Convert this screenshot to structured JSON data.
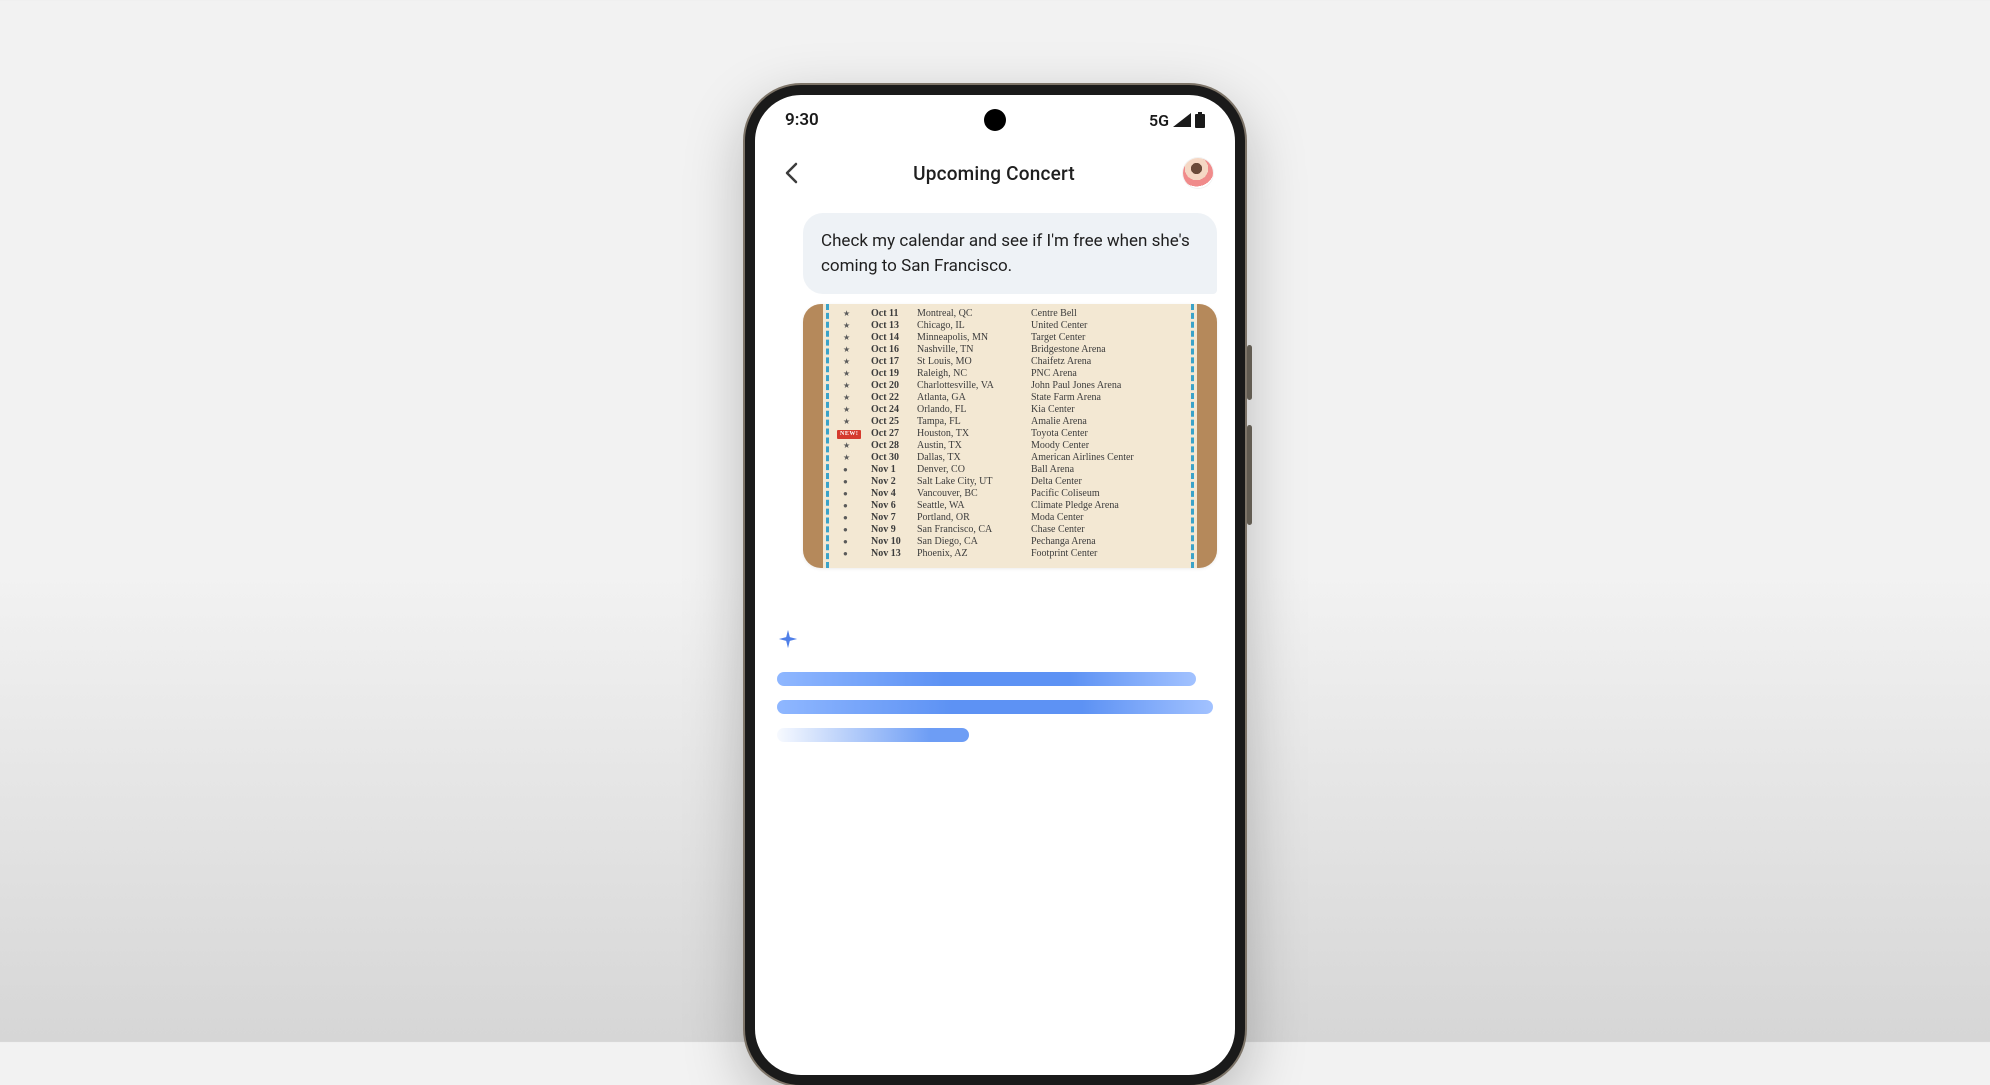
{
  "status": {
    "time": "9:30",
    "network": "5G"
  },
  "header": {
    "title": "Upcoming Concert"
  },
  "message": {
    "text": "Check my calendar and see if I'm free when she's coming to San Francisco."
  },
  "tour": {
    "new_label": "NEW!",
    "rows": [
      {
        "mark": "★",
        "date": "Oct 11",
        "city": "Montreal, QC",
        "venue": "Centre Bell"
      },
      {
        "mark": "★",
        "date": "Oct 13",
        "city": "Chicago, IL",
        "venue": "United Center"
      },
      {
        "mark": "★",
        "date": "Oct 14",
        "city": "Minneapolis, MN",
        "venue": "Target Center"
      },
      {
        "mark": "★",
        "date": "Oct 16",
        "city": "Nashville, TN",
        "venue": "Bridgestone Arena"
      },
      {
        "mark": "★",
        "date": "Oct 17",
        "city": "St Louis, MO",
        "venue": "Chaifetz Arena"
      },
      {
        "mark": "★",
        "date": "Oct 19",
        "city": "Raleigh, NC",
        "venue": "PNC Arena"
      },
      {
        "mark": "★",
        "date": "Oct 20",
        "city": "Charlottesville, VA",
        "venue": "John Paul Jones Arena"
      },
      {
        "mark": "★",
        "date": "Oct 22",
        "city": "Atlanta, GA",
        "venue": "State Farm Arena"
      },
      {
        "mark": "★",
        "date": "Oct 24",
        "city": "Orlando, FL",
        "venue": "Kia Center"
      },
      {
        "mark": "★",
        "date": "Oct 25",
        "city": "Tampa, FL",
        "venue": "Amalie Arena"
      },
      {
        "mark": "★",
        "date": "Oct 27",
        "city": "Houston, TX",
        "venue": "Toyota Center",
        "is_new": true
      },
      {
        "mark": "★",
        "date": "Oct 28",
        "city": "Austin, TX",
        "venue": "Moody Center"
      },
      {
        "mark": "★",
        "date": "Oct 30",
        "city": "Dallas, TX",
        "venue": "American Airlines Center"
      },
      {
        "mark": "●",
        "date": "Nov 1",
        "city": "Denver, CO",
        "venue": "Ball Arena"
      },
      {
        "mark": "●",
        "date": "Nov 2",
        "city": "Salt Lake City, UT",
        "venue": "Delta Center"
      },
      {
        "mark": "●",
        "date": "Nov 4",
        "city": "Vancouver, BC",
        "venue": "Pacific Coliseum"
      },
      {
        "mark": "●",
        "date": "Nov 6",
        "city": "Seattle, WA",
        "venue": "Climate Pledge Arena"
      },
      {
        "mark": "●",
        "date": "Nov 7",
        "city": "Portland, OR",
        "venue": "Moda Center"
      },
      {
        "mark": "●",
        "date": "Nov 9",
        "city": "San Francisco, CA",
        "venue": "Chase Center"
      },
      {
        "mark": "●",
        "date": "Nov 10",
        "city": "San Diego, CA",
        "venue": "Pechanga Arena"
      },
      {
        "mark": "●",
        "date": "Nov 13",
        "city": "Phoenix, AZ",
        "venue": "Footprint Center"
      }
    ]
  }
}
